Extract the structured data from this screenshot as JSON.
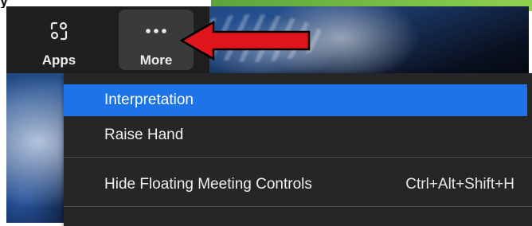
{
  "caption_fragment": "y",
  "toolbar": {
    "apps_label": "Apps",
    "more_label": "More"
  },
  "menu": {
    "items": [
      {
        "label": "Interpretation",
        "shortcut": ""
      },
      {
        "label": "Raise Hand",
        "shortcut": ""
      },
      {
        "label": "Hide Floating Meeting Controls",
        "shortcut": "Ctrl+Alt+Shift+H"
      }
    ]
  },
  "colors": {
    "highlight": "#1c74e8",
    "arrow": "#e0141b",
    "menu_bg": "#262626",
    "toolbar_bg": "#1f1f1f"
  },
  "icons": [
    "apps-icon",
    "more-ellipsis-icon",
    "red-arrow-icon"
  ]
}
